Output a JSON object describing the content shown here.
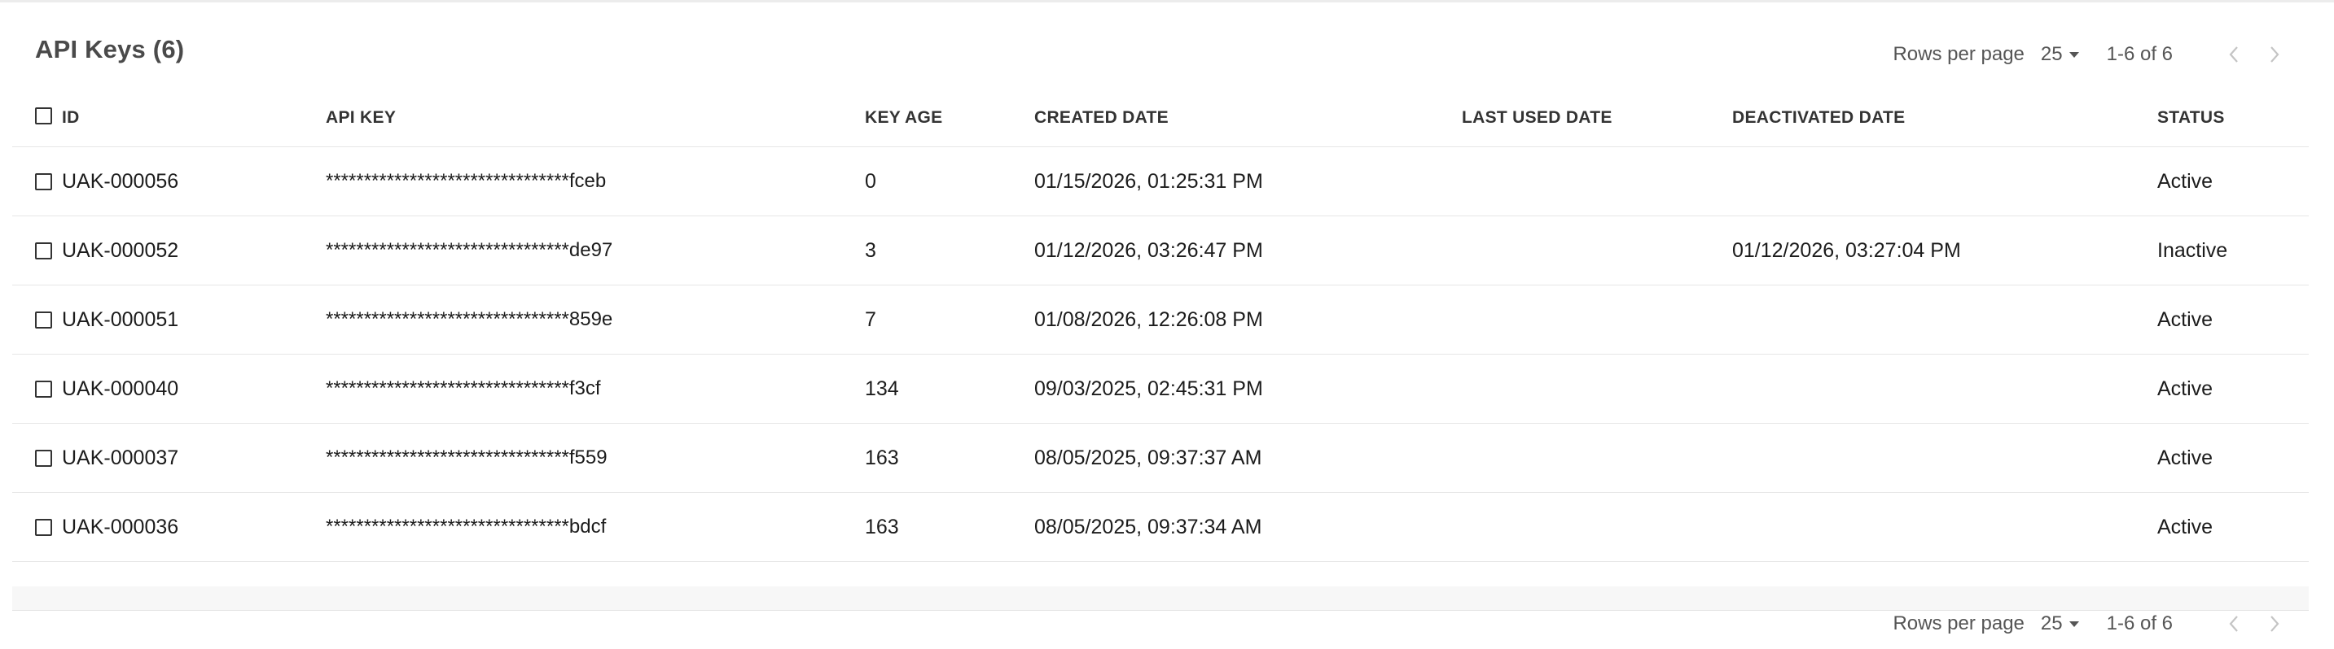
{
  "title": "API Keys (6)",
  "pagination": {
    "rows_per_page_label": "Rows per page",
    "rows_per_page_value": "25",
    "range_text": "1-6 of 6"
  },
  "columns": {
    "id": "ID",
    "api_key": "API KEY",
    "key_age": "KEY AGE",
    "created_date": "CREATED DATE",
    "last_used_date": "LAST USED DATE",
    "deactivated_date": "DEACTIVATED DATE",
    "status": "STATUS"
  },
  "rows": [
    {
      "id": "UAK-000056",
      "api_key": "********************************fceb",
      "key_age": "0",
      "created_date": "01/15/2026, 01:25:31 PM",
      "last_used_date": "",
      "deactivated_date": "",
      "status": "Active"
    },
    {
      "id": "UAK-000052",
      "api_key": "********************************de97",
      "key_age": "3",
      "created_date": "01/12/2026, 03:26:47 PM",
      "last_used_date": "",
      "deactivated_date": "01/12/2026, 03:27:04 PM",
      "status": "Inactive"
    },
    {
      "id": "UAK-000051",
      "api_key": "********************************859e",
      "key_age": "7",
      "created_date": "01/08/2026, 12:26:08 PM",
      "last_used_date": "",
      "deactivated_date": "",
      "status": "Active"
    },
    {
      "id": "UAK-000040",
      "api_key": "********************************f3cf",
      "key_age": "134",
      "created_date": "09/03/2025, 02:45:31 PM",
      "last_used_date": "",
      "deactivated_date": "",
      "status": "Active"
    },
    {
      "id": "UAK-000037",
      "api_key": "********************************f559",
      "key_age": "163",
      "created_date": "08/05/2025, 09:37:37 AM",
      "last_used_date": "",
      "deactivated_date": "",
      "status": "Active"
    },
    {
      "id": "UAK-000036",
      "api_key": "********************************bdcf",
      "key_age": "163",
      "created_date": "08/05/2025, 09:37:34 AM",
      "last_used_date": "",
      "deactivated_date": "",
      "status": "Active"
    }
  ],
  "icons": {
    "prev": "chevron-left-icon",
    "next": "chevron-right-icon",
    "dropdown": "caret-down-icon",
    "checkbox": "checkbox-unchecked-icon"
  }
}
